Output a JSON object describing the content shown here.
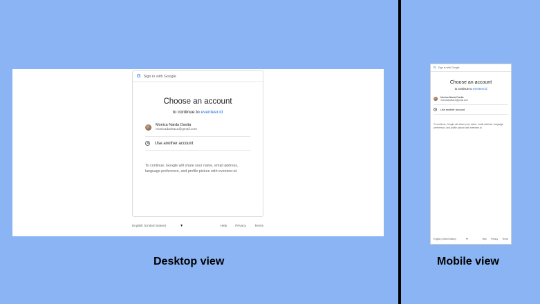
{
  "google_signin": {
    "header": "Sign in with Google",
    "title": "Choose an account",
    "subtitle_prefix": "to continue to ",
    "site": "eventeer.id",
    "account": {
      "name": "Monica Narda Davita",
      "email": "monicadavita11@gmail.com"
    },
    "another_account": "Use another account",
    "disclaimer": "To continue, Google will share your name, email address, language preference, and profile picture with eventeer.id.",
    "language": "English (United States)",
    "footer_links": [
      "Help",
      "Privacy",
      "Terms"
    ]
  },
  "captions": {
    "desktop": "Desktop view",
    "mobile": "Mobile view"
  },
  "colors": {
    "background": "#8ab4f4",
    "link": "#1a73e8",
    "divider": "#000000"
  },
  "icons": {
    "logo": "google-g-icon",
    "person": "account-circle-icon",
    "dropdown": "caret-down-icon"
  }
}
